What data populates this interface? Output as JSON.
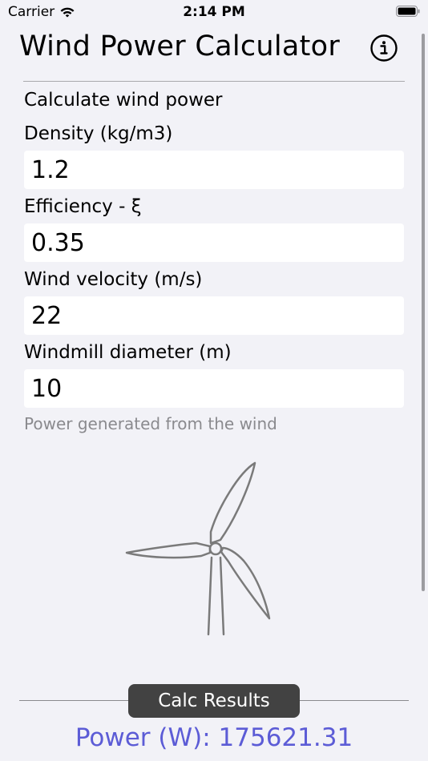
{
  "status_bar": {
    "carrier": "Carrier",
    "time": "2:14 PM"
  },
  "header": {
    "title": "Wind Power Calculator",
    "info_icon": "info-circle-icon"
  },
  "form": {
    "section_label": "Calculate wind power",
    "fields": [
      {
        "label": "Density (kg/m3)",
        "value": "1.2"
      },
      {
        "label": "Efficiency - ξ",
        "value": "0.35"
      },
      {
        "label": "Wind velocity (m/s)",
        "value": "22"
      },
      {
        "label": "Windmill diameter (m)",
        "value": "10"
      }
    ],
    "hint": "Power generated from the wind"
  },
  "illustration": {
    "icon": "wind-turbine-icon"
  },
  "footer": {
    "calc_button_label": "Calc Results",
    "result_text": "Power (W): 175621.31"
  },
  "colors": {
    "background": "#f2f2f7",
    "button": "#424242",
    "result": "#5c5cd6",
    "hint": "#8a8a8e"
  }
}
